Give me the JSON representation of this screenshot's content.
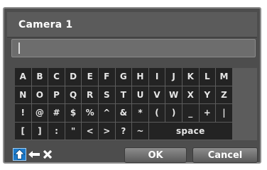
{
  "dialog": {
    "title": "Camera 1"
  },
  "input": {
    "value": ""
  },
  "keyboard": {
    "rows": [
      [
        "A",
        "B",
        "C",
        "D",
        "E",
        "F",
        "G",
        "H",
        "I",
        "J",
        "K",
        "L",
        "M"
      ],
      [
        "N",
        "O",
        "P",
        "Q",
        "R",
        "S",
        "T",
        "U",
        "V",
        "W",
        "X",
        "Y",
        "Z"
      ],
      [
        "!",
        "@",
        "#",
        "$",
        "%",
        "^",
        "&",
        "*",
        "(",
        ")",
        "_",
        "+",
        "|"
      ],
      [
        "[",
        "]",
        ":",
        "\"",
        "<",
        ">",
        "?",
        "~"
      ]
    ],
    "space_label": "space"
  },
  "controls": {
    "shift_icon": "shift-icon",
    "backspace_icon": "backspace-arrow-icon",
    "clear_icon": "clear-x-icon"
  },
  "buttons": {
    "ok": "OK",
    "cancel": "Cancel"
  },
  "colors": {
    "shift_active": "#1b79c9",
    "dialog_bg": "#4d4d4d",
    "key_bg": "#232323"
  }
}
